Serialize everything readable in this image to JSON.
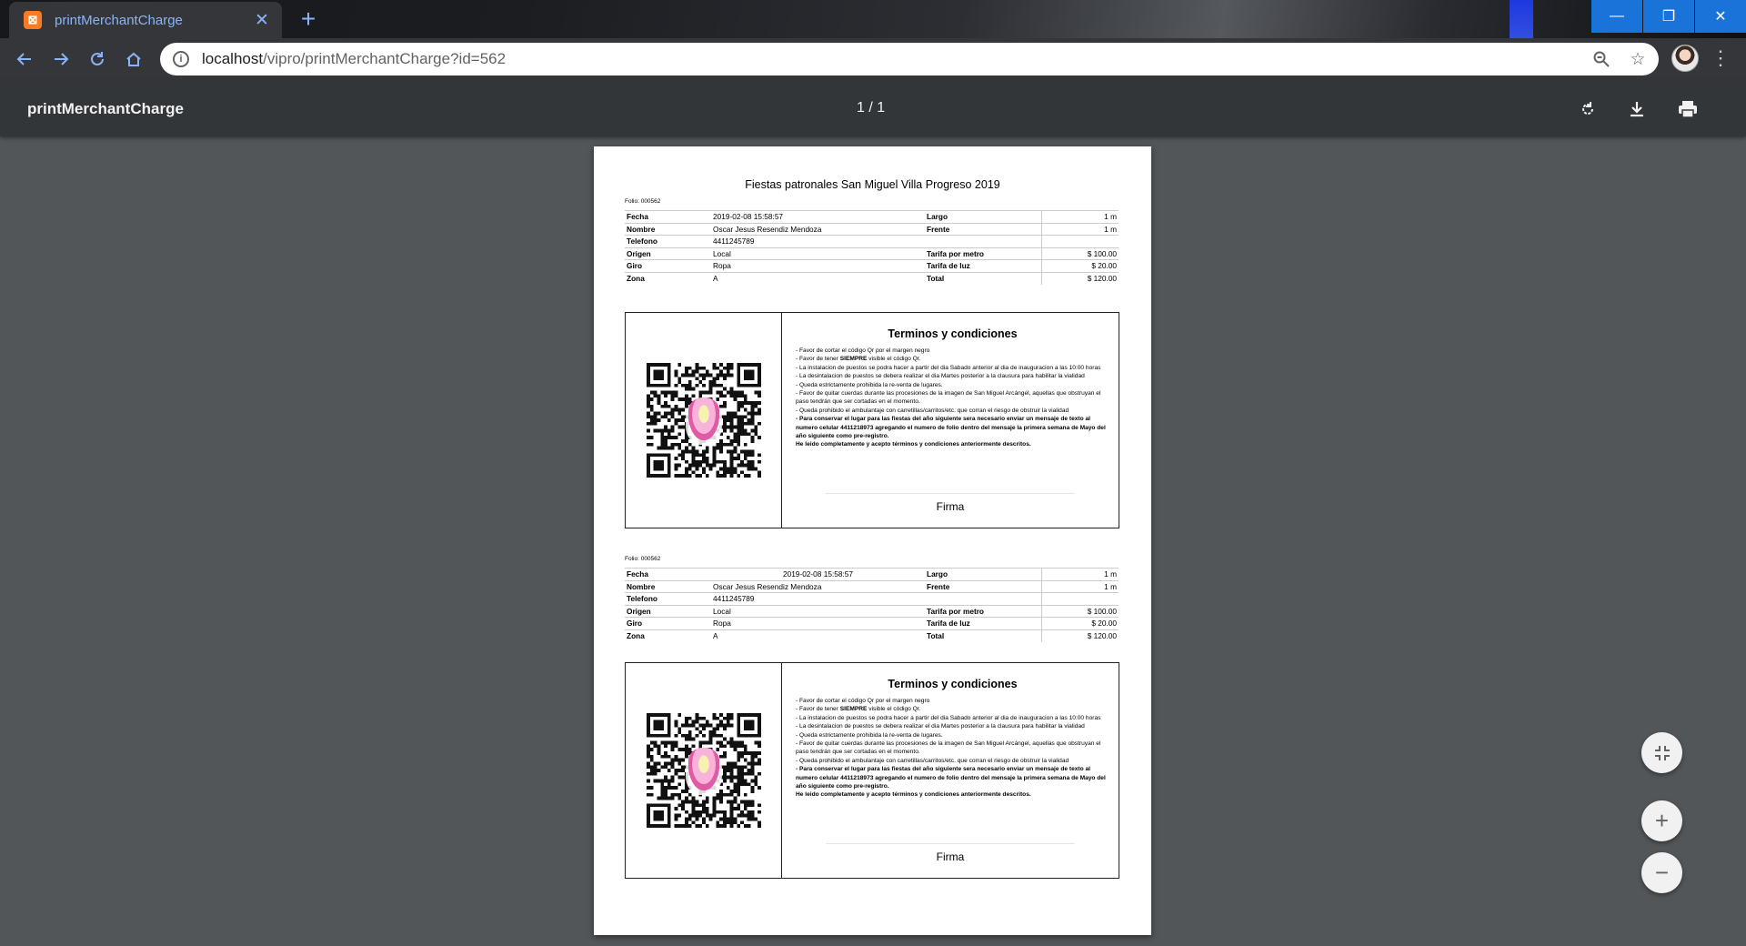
{
  "browser": {
    "tab": {
      "title": "printMerchantCharge",
      "favicon_letter": "⊠"
    },
    "url_host": "localhost",
    "url_path": "/vipro/printMerchantCharge?id=562"
  },
  "viewer": {
    "title": "printMerchantCharge",
    "page_indicator": "1 / 1"
  },
  "document": {
    "title": "Fiestas patronales San Miguel Villa Progreso 2019",
    "copies": [
      {
        "folio": "Folio: 000562",
        "rows": [
          {
            "label": "Fecha",
            "value": "2019-02-08 15:58:57",
            "label2": "Largo",
            "value2": "1 m"
          },
          {
            "label": "Nombre",
            "value": "Oscar Jesus Resendiz Mendoza",
            "label2": "Frente",
            "value2": "1 m"
          },
          {
            "label": "Telefono",
            "value": "4411245789",
            "label2": "",
            "value2": ""
          },
          {
            "label": "Origen",
            "value": "Local",
            "label2": "Tarifa por metro",
            "value2": "$ 100.00"
          },
          {
            "label": "Giro",
            "value": "Ropa",
            "label2": "Tarifa de luz",
            "value2": "$ 20.00"
          },
          {
            "label": "Zona",
            "value": "A",
            "label2": "Total",
            "value2": "$ 120.00"
          }
        ]
      },
      {
        "folio": "Folio: 000562",
        "rows": [
          {
            "label": "Fecha",
            "value": "2019-02-08 15:58:57",
            "label2": "Largo",
            "value2": "1 m"
          },
          {
            "label": "Nombre",
            "value": "Oscar Jesus Resendiz Mendoza",
            "label2": "Frente",
            "value2": "1 m"
          },
          {
            "label": "Telefono",
            "value": "4411245789",
            "label2": "",
            "value2": ""
          },
          {
            "label": "Origen",
            "value": "Local",
            "label2": "Tarifa por metro",
            "value2": "$ 100.00"
          },
          {
            "label": "Giro",
            "value": "Ropa",
            "label2": "Tarifa de luz",
            "value2": "$ 20.00"
          },
          {
            "label": "Zona",
            "value": "A",
            "label2": "Total",
            "value2": "$ 120.00"
          }
        ]
      }
    ],
    "terms": {
      "title": "Terminos y condiciones",
      "lines": [
        {
          "text": "- Favor de cortar el código Qr por el margen negro",
          "bold": false
        },
        {
          "pre": "- Favor de tener ",
          "strong": "SIEMPRE",
          "post": " visible el código Qr."
        },
        {
          "text": "- La instalacion de puestos se podra hacer a partir del dia Sabado anterior al dia de inauguracion a las 10:00 horas",
          "bold": false
        },
        {
          "text": "- La desintalacion de puestos se debera realizar el dia Martes posterior a la clausura para habilitar la vialidad",
          "bold": false
        },
        {
          "text": "- Queda estrictamente prohibida la re-venta de lugares.",
          "bold": false
        },
        {
          "text": "- Favor de quitar cuerdas durante las procesiones de la imagen de San Miguel Arcángel, aquellas que obstruyan el paso tendrán que ser cortadas en el momento.",
          "bold": false
        },
        {
          "text": "- Queda prohibido el ambulantaje con carretillas/carritos/etc. que corran el riesgo de obstruir la vialidad",
          "bold": false
        },
        {
          "text": "- Para conservar el lugar para las fiestas del año siguiente sera necesario enviar un mensaje de texto al numero celular 4411218973 agregando el numero de folio dentro del mensaje la primera semana de Mayo del año siguiente como pre-registro.",
          "bold": true
        },
        {
          "text": "He leido completamente y acepto términos y condiciones anteriormente descritos.",
          "bold": true
        }
      ],
      "signature_label": "Firma"
    }
  }
}
